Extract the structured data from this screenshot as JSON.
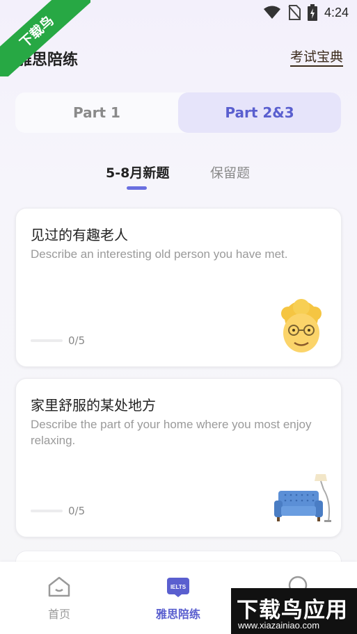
{
  "status_bar": {
    "time": "4:24"
  },
  "corner_ribbon": {
    "text": "下载鸟"
  },
  "header": {
    "title": "雅思陪练",
    "link": "考试宝典"
  },
  "part_switch": {
    "tabs": [
      "Part 1",
      "Part 2&3"
    ],
    "active_index": 1
  },
  "sub_tabs": {
    "active": "5-8月新题",
    "inactive": "保留题"
  },
  "cards": [
    {
      "title": "见过的有趣老人",
      "desc": "Describe an interesting old person you have met.",
      "progress": "0/5",
      "icon": "old-person-emoji-icon"
    },
    {
      "title": "家里舒服的某处地方",
      "desc": "Describe the part of your home where you most enjoy relaxing.",
      "progress": "0/5",
      "icon": "sofa-lamp-icon"
    }
  ],
  "bottom_nav": {
    "home": "首页",
    "practice": "雅思陪练",
    "practice_badge": "IELTS"
  },
  "watermark": {
    "title": "下载鸟应用",
    "url": "www.xiazainiao.com"
  },
  "colors": {
    "accent": "#5a5fcf",
    "ribbon": "#27a844"
  }
}
